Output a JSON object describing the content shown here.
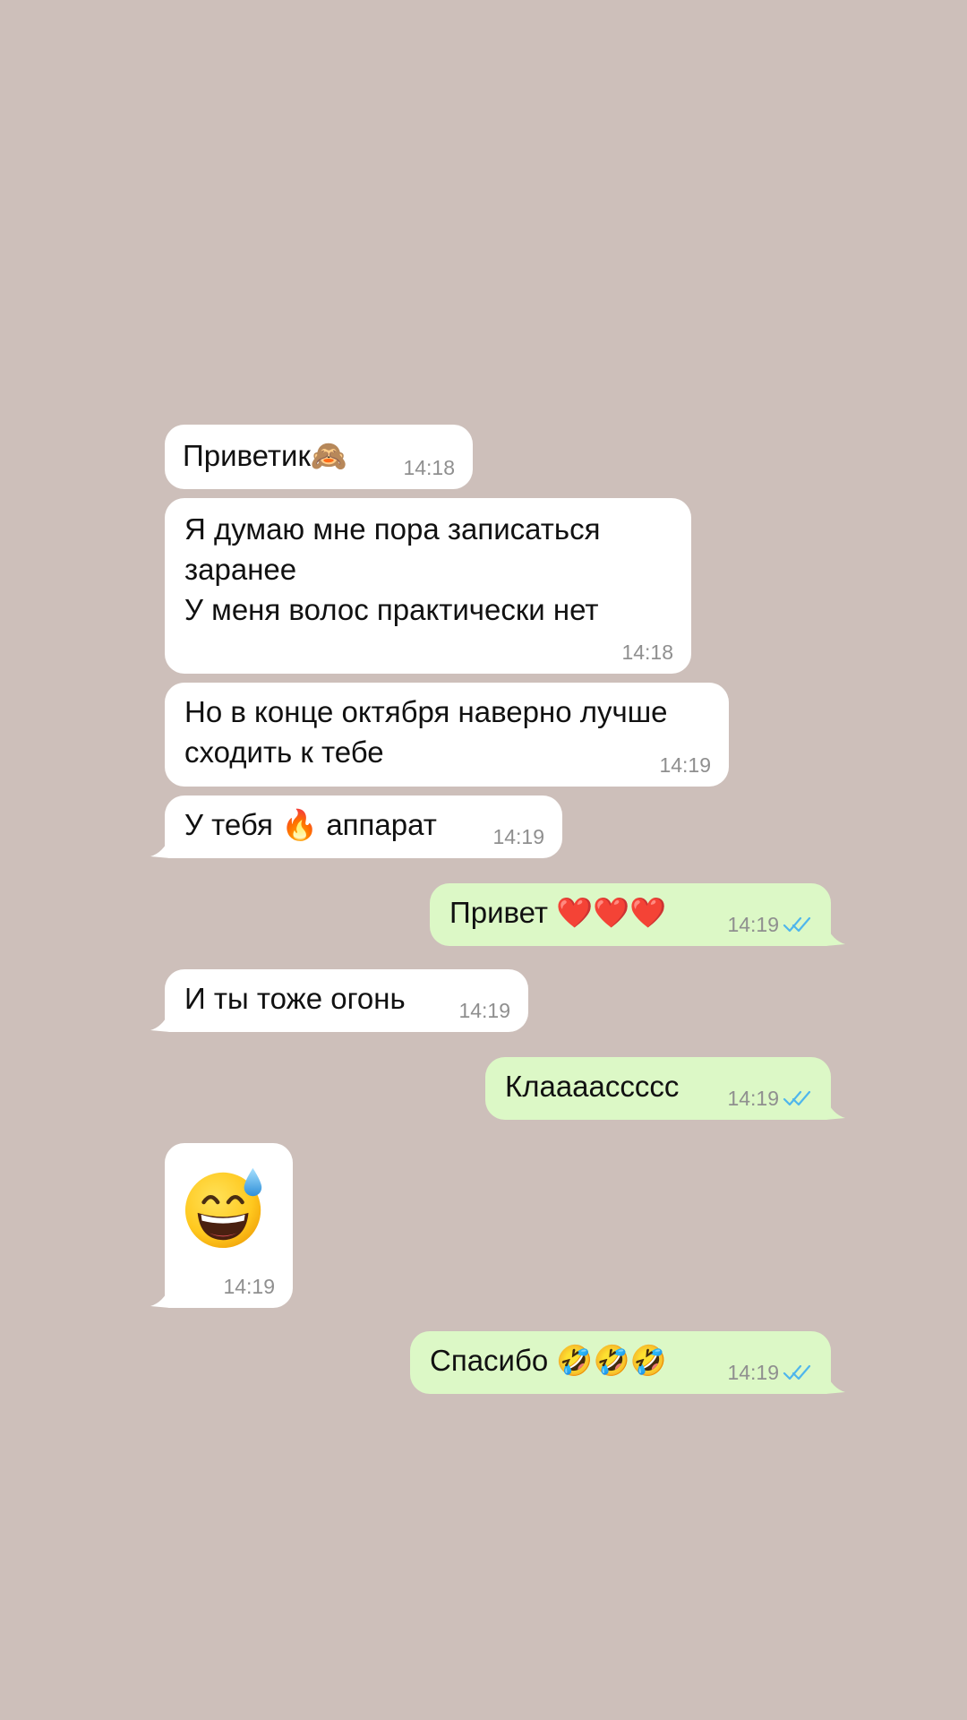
{
  "messages": [
    {
      "side": "in",
      "text": "Приветик",
      "emoji": "🙈",
      "time": "14:18"
    },
    {
      "side": "in",
      "text": "Я думаю мне пора записаться\nзаранее\nУ меня волос практически нет",
      "time": "14:18"
    },
    {
      "side": "in",
      "text": "Но в конце октября наверно лучше\nсходить к тебе",
      "time": "14:19"
    },
    {
      "side": "in",
      "text": "У тебя 🔥 аппарат",
      "time": "14:19"
    },
    {
      "side": "out",
      "text": "Привет ❤️❤️❤️",
      "time": "14:19",
      "status": "double-check-read"
    },
    {
      "side": "in",
      "text": "И ты тоже огонь",
      "time": "14:19"
    },
    {
      "side": "out",
      "text": "Клааааccccc",
      "time": "14:19",
      "status": "double-check-read"
    },
    {
      "side": "in",
      "emoji_only": "😅",
      "time": "14:19"
    },
    {
      "side": "out",
      "text": "Спасибо 🤣🤣🤣",
      "time": "14:19",
      "status": "double-check-read"
    }
  ],
  "colors": {
    "background": "#cdbfba",
    "incoming_bubble": "#ffffff",
    "outgoing_bubble": "#dcf8c6",
    "timestamp": "#8f8f8f",
    "read_ticks": "#4fb6ec"
  },
  "icons": {
    "read_receipt": "double-check-icon"
  }
}
